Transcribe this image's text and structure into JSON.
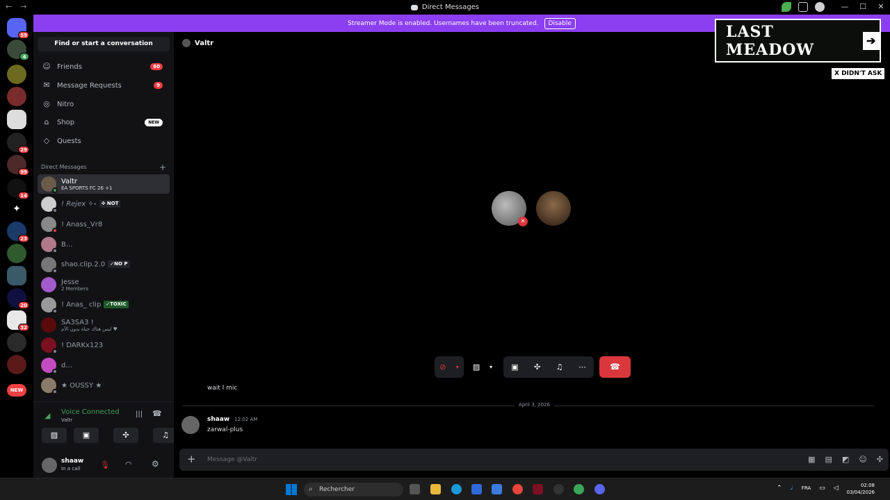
{
  "window": {
    "title": "Direct Messages",
    "back": "←",
    "forward": "→",
    "minimize": "—",
    "maximize": "☐",
    "close": "✕"
  },
  "guild_badges": [
    "59",
    "4",
    "29",
    "99",
    "14",
    "23",
    "20",
    "32",
    "NEW"
  ],
  "banner": {
    "text": "Streamer Mode is enabled. Usernames have been truncated.",
    "button": "Disable"
  },
  "sidebar": {
    "search": "Find or start a conversation",
    "nav": [
      {
        "label": "Friends",
        "icon": "☺",
        "count": "60"
      },
      {
        "label": "Message Requests",
        "icon": "✉",
        "count": "9"
      },
      {
        "label": "Nitro",
        "icon": "◎",
        "count": ""
      },
      {
        "label": "Shop",
        "icon": "⌂",
        "badge": "NEW"
      },
      {
        "label": "Quests",
        "icon": "◇",
        "count": ""
      }
    ],
    "dm_header": "Direct Messages",
    "dm_add": "+",
    "dms": [
      {
        "name": "Valtr",
        "sub": "EA SPORTS FC 26 +1",
        "tag": ""
      },
      {
        "name": "! Rejex ✧˖",
        "sub": "",
        "tag": "✜ NOT"
      },
      {
        "name": "! Anass_Vr8",
        "sub": "",
        "tag": ""
      },
      {
        "name": "B...",
        "sub": "",
        "tag": ""
      },
      {
        "name": "shao.clip.2.0",
        "sub": "",
        "tag": "✓NO P"
      },
      {
        "name": "Jesse",
        "sub": "2 Members",
        "tag": ""
      },
      {
        "name": "! Anas_ clip",
        "sub": "",
        "tag": "✓TOXIC"
      },
      {
        "name": "SA3SA3 !",
        "sub": "ليس هناك حياة بدون الأم ♥",
        "tag": ""
      },
      {
        "name": "! DARKx123",
        "sub": "",
        "tag": ""
      },
      {
        "name": "d...",
        "sub": "",
        "tag": ""
      },
      {
        "name": "★ OUSSY ★",
        "sub": "",
        "tag": ""
      }
    ]
  },
  "voice": {
    "status": "Voice Connected",
    "channel": "Valtr"
  },
  "user": {
    "name": "shaaw",
    "status": "In a call"
  },
  "channel": {
    "name": "Valtr"
  },
  "overlay": {
    "ad": "LAST MEADOW",
    "ad_arrow": "➔",
    "badge": "X DIDN'T ASK"
  },
  "messages": {
    "prev": "wait l mic",
    "date": "April 3, 2026",
    "author": "shaaw",
    "time": "12:02 AM",
    "text": "zarwal-plus"
  },
  "composer": {
    "placeholder": "Message @Valtr",
    "add": "+"
  },
  "taskbar": {
    "search": "Rechercher",
    "lang": "FRA",
    "time": "02:08",
    "date": "03/04/2026"
  },
  "colors": {
    "accent": "#8c3ff0",
    "danger": "#da373c",
    "online": "#43a25a"
  }
}
